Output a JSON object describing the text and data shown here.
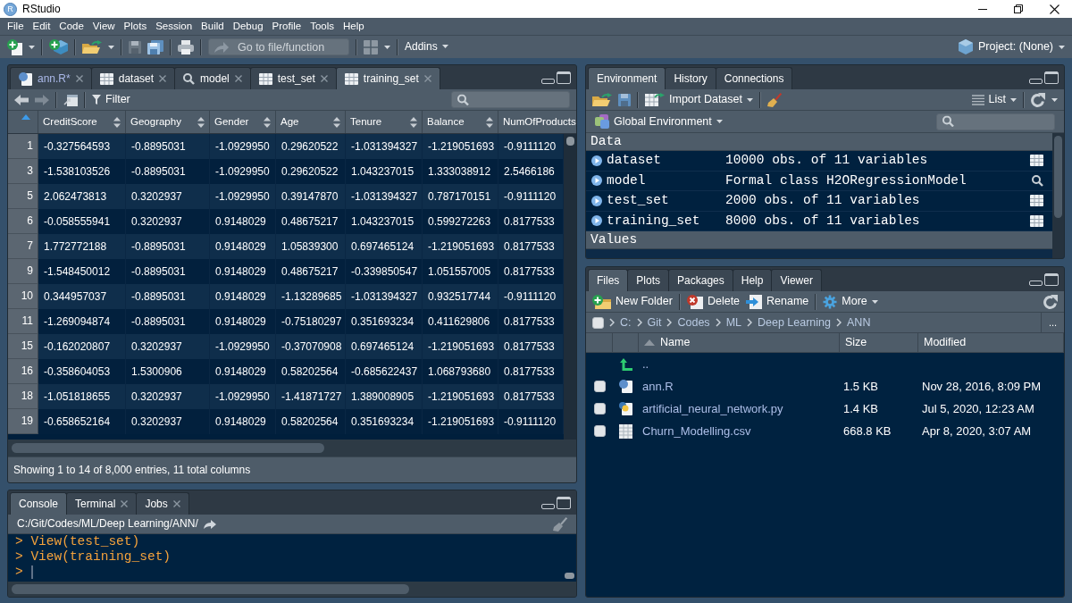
{
  "title_bar": {
    "logo": "R",
    "title": "RStudio"
  },
  "menu": [
    "File",
    "Edit",
    "Code",
    "View",
    "Plots",
    "Session",
    "Build",
    "Debug",
    "Profile",
    "Tools",
    "Help"
  ],
  "toolbar": {
    "go_to": {
      "placeholder": "Go to file/function"
    },
    "addins": "Addins",
    "project": "Project: (None)"
  },
  "source_pane": {
    "tabs": [
      {
        "label": "ann.R*",
        "kind": "script",
        "modified": true,
        "selected": false
      },
      {
        "label": "dataset",
        "kind": "data",
        "modified": false,
        "selected": false
      },
      {
        "label": "model",
        "kind": "object",
        "modified": false,
        "selected": false
      },
      {
        "label": "test_set",
        "kind": "data",
        "modified": false,
        "selected": false
      },
      {
        "label": "training_set",
        "kind": "data",
        "modified": false,
        "selected": true
      }
    ],
    "filter": "Filter",
    "table": {
      "columns": [
        "CreditScore",
        "Geography",
        "Gender",
        "Age",
        "Tenure",
        "Balance",
        "NumOfProducts"
      ],
      "rows": [
        {
          "index": "1",
          "cells": [
            "-0.327564593",
            "-0.8895031",
            "-1.0929950",
            "0.29620522",
            "-1.031394327",
            "-1.219051693",
            "-0.9111120"
          ]
        },
        {
          "index": "3",
          "cells": [
            "-1.538103526",
            "-0.8895031",
            "-1.0929950",
            "0.29620522",
            "1.043237015",
            "1.333038912",
            "2.5466186"
          ]
        },
        {
          "index": "5",
          "cells": [
            "2.062473813",
            "0.3202937",
            "-1.0929950",
            "0.39147870",
            "-1.031394327",
            "0.787170151",
            "-0.9111120"
          ]
        },
        {
          "index": "6",
          "cells": [
            "-0.058555941",
            "0.3202937",
            "0.9148029",
            "0.48675217",
            "1.043237015",
            "0.599272263",
            "0.8177533"
          ]
        },
        {
          "index": "7",
          "cells": [
            "1.772772188",
            "-0.8895031",
            "0.9148029",
            "1.05839300",
            "0.697465124",
            "-1.219051693",
            "0.8177533"
          ]
        },
        {
          "index": "9",
          "cells": [
            "-1.548450012",
            "-0.8895031",
            "0.9148029",
            "0.48675217",
            "-0.339850547",
            "1.051557005",
            "0.8177533"
          ]
        },
        {
          "index": "10",
          "cells": [
            "0.344957037",
            "-0.8895031",
            "0.9148029",
            "-1.13289685",
            "-1.031394327",
            "0.932517744",
            "-0.9111120"
          ]
        },
        {
          "index": "11",
          "cells": [
            "-1.269094874",
            "-0.8895031",
            "0.9148029",
            "-0.75180297",
            "0.351693234",
            "0.411629806",
            "0.8177533"
          ]
        },
        {
          "index": "15",
          "cells": [
            "-0.162020807",
            "0.3202937",
            "-1.0929950",
            "-0.37070908",
            "0.697465124",
            "-1.219051693",
            "0.8177533"
          ]
        },
        {
          "index": "16",
          "cells": [
            "-0.358604053",
            "1.5300906",
            "0.9148029",
            "0.58202564",
            "-0.685622437",
            "1.068793680",
            "0.8177533"
          ]
        },
        {
          "index": "18",
          "cells": [
            "-1.051818655",
            "0.3202937",
            "-1.0929950",
            "-1.41871727",
            "1.389008905",
            "-1.219051693",
            "0.8177533"
          ]
        },
        {
          "index": "19",
          "cells": [
            "-0.658652164",
            "0.3202937",
            "0.9148029",
            "0.58202564",
            "0.351693234",
            "-1.219051693",
            "-0.9111120"
          ]
        }
      ]
    },
    "status": "Showing 1 to 14 of 8,000 entries, 11 total columns"
  },
  "environment_pane": {
    "tabs": [
      {
        "label": "Environment",
        "selected": true
      },
      {
        "label": "History",
        "selected": false
      },
      {
        "label": "Connections",
        "selected": false
      }
    ],
    "import": "Import Dataset",
    "view": "List",
    "scope": "Global Environment",
    "sections": [
      {
        "title": "Data",
        "rows": [
          {
            "name": "dataset",
            "value": "10000 obs. of 11 variables",
            "kind": "table",
            "expanded": false
          },
          {
            "name": "model",
            "value": "Formal class H2ORegressionModel",
            "kind": "object",
            "expanded": false
          },
          {
            "name": "test_set",
            "value": "2000 obs. of 11 variables",
            "kind": "table",
            "expanded": false
          },
          {
            "name": "training_set",
            "value": "8000 obs. of 11 variables",
            "kind": "table",
            "expanded": false
          }
        ]
      },
      {
        "title": "Values"
      }
    ]
  },
  "files_pane": {
    "tabs": [
      {
        "label": "Files",
        "selected": true
      },
      {
        "label": "Plots",
        "selected": false
      },
      {
        "label": "Packages",
        "selected": false
      },
      {
        "label": "Help",
        "selected": false
      },
      {
        "label": "Viewer",
        "selected": false
      }
    ],
    "actions": [
      {
        "label": "New Folder",
        "kind": "new_folder"
      },
      {
        "label": "Delete",
        "kind": "delete"
      },
      {
        "label": "Rename",
        "kind": "rename"
      },
      {
        "label": "More",
        "kind": "more"
      }
    ],
    "select_all": {
      "checked": false
    },
    "path": [
      "C:",
      "Git",
      "Codes",
      "ML",
      "Deep Learning",
      "ANN"
    ],
    "path_more": "...",
    "columns": [
      "Name",
      "Size",
      "Modified"
    ],
    "files": [
      {
        "kind": "parent",
        "name": ".."
      },
      {
        "kind": "r",
        "name": "ann.R",
        "size": "1.5 KB",
        "modified": "Nov 28, 2016, 8:09 PM",
        "checked": false
      },
      {
        "kind": "python",
        "name": "artificial_neural_network.py",
        "size": "1.4 KB",
        "modified": "Jul 5, 2020, 12:23 AM",
        "checked": false
      },
      {
        "kind": "csv",
        "name": "Churn_Modelling.csv",
        "size": "668.8 KB",
        "modified": "Apr 8, 2020, 3:07 AM",
        "checked": false
      }
    ]
  },
  "console_pane": {
    "tabs": [
      {
        "label": "Console",
        "selected": true,
        "closable": false
      },
      {
        "label": "Terminal",
        "selected": false,
        "closable": true
      },
      {
        "label": "Jobs",
        "selected": false,
        "closable": true
      }
    ],
    "working_dir": "C:/Git/Codes/ML/Deep Learning/ANN/",
    "lines": [
      "> View(test_set)",
      "> View(training_set)",
      ">"
    ]
  }
}
